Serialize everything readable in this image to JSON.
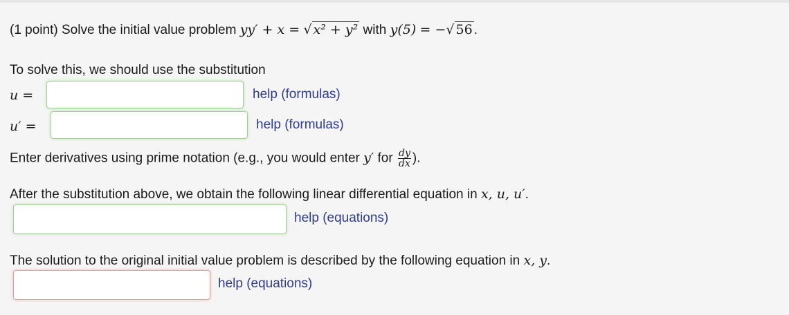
{
  "problem": {
    "prefix": "(1 point) Solve the initial value problem",
    "eq_lhs": "yy′ + x =",
    "radicand": "x² + y²",
    "with": "with",
    "ic_lhs": "y(5)",
    "ic_eq": "= −",
    "ic_val": "56",
    "period": "."
  },
  "substitution": {
    "intro": "To solve this, we should use the substitution",
    "u_label": "u =",
    "uprime_label": "u′ =",
    "help_formulas": "help (formulas)"
  },
  "derivative_note": {
    "text": "Enter derivatives using prime notation (e.g., you would enter",
    "yprime": "y′",
    "for": "for",
    "frac_num": "dy",
    "frac_den": "dx",
    "close": ")."
  },
  "linear_eq": {
    "text": "After the substitution above, we obtain the following linear differential equation in",
    "vars": "x, u, u′",
    "period": ".",
    "help": "help (equations)"
  },
  "solution": {
    "text": "The solution to the original initial value problem is described by the following equation in",
    "vars": "x, y",
    "period": ".",
    "help": "help (equations)"
  },
  "fields": {
    "u": "",
    "uprime": "",
    "linear": "",
    "solution": ""
  },
  "colors": {
    "correct_border": "#9fcf94",
    "incorrect_border": "#e79a9a",
    "help_link": "#2f3c8b"
  }
}
